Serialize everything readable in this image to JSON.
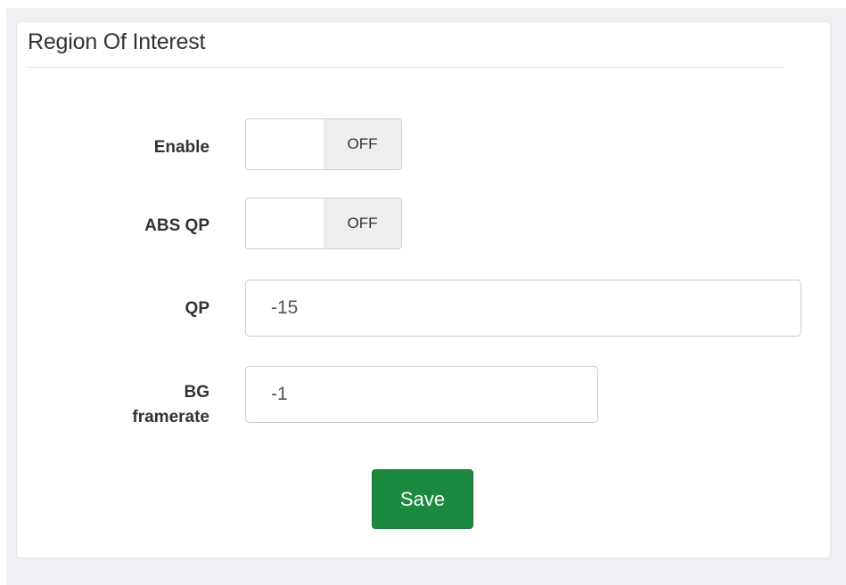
{
  "section": {
    "title": "Region Of Interest"
  },
  "fields": {
    "enable": {
      "label": "Enable",
      "state": "OFF"
    },
    "abs_qp": {
      "label": "ABS QP",
      "state": "OFF"
    },
    "qp": {
      "label": "QP",
      "value": "-15"
    },
    "bg_framerate": {
      "label_line1": "BG",
      "label_line2": "framerate",
      "value": "-1"
    }
  },
  "actions": {
    "save_label": "Save"
  },
  "colors": {
    "page_background": "#eef0f4",
    "card_background": "#ffffff",
    "save_button": "#1b8a3e",
    "toggle_off_background": "#eeeeee"
  }
}
